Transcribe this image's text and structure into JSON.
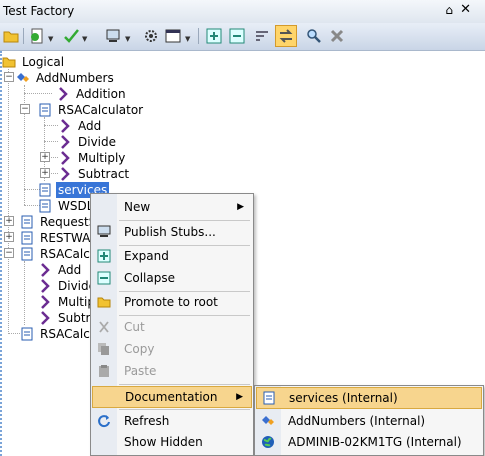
{
  "window": {
    "title": "Test Factory",
    "pin_glyph": "⌂",
    "close_glyph": "✕"
  },
  "toolbar": {
    "icons": [
      "open-folder-icon",
      "new-document-icon",
      "check-icon",
      "monitor-icon",
      "gear-icon",
      "layout-icon",
      "expand-icon",
      "collapse-icon",
      "sort-icon",
      "sync-icon",
      "search-icon",
      "clear-icon"
    ]
  },
  "tree": {
    "logical": "Logical",
    "add_numbers": "AddNumbers",
    "addition": "Addition",
    "rsacalculator": "RSACalculator",
    "add": "Add",
    "divide": "Divide",
    "multiply": "Multiply",
    "subtract": "Subtract",
    "services": "services",
    "wsdl": "WSDL",
    "request": "RequestS",
    "restwa": "RESTWA",
    "rsacalcu1": "RSACalcu",
    "add2": "Add",
    "divide2": "Divide",
    "multip2": "Multip",
    "subtra2": "Subtra",
    "rsacalcu2": "RSACalcu"
  },
  "context_menu": {
    "new": "New",
    "publish_stubs": "Publish Stubs...",
    "expand": "Expand",
    "collapse": "Collapse",
    "promote": "Promote to root",
    "cut": "Cut",
    "copy": "Copy",
    "paste": "Paste",
    "documentation": "Documentation",
    "refresh": "Refresh",
    "show_hidden": "Show Hidden"
  },
  "submenu": {
    "services": "services (Internal)",
    "addnumbers": "AddNumbers (Internal)",
    "host": "ADMINIB-02KM1TG (Internal)"
  },
  "colors": {
    "selection": "#3875d7",
    "hover": "#f7d58e",
    "operation": "#6b2c91"
  }
}
